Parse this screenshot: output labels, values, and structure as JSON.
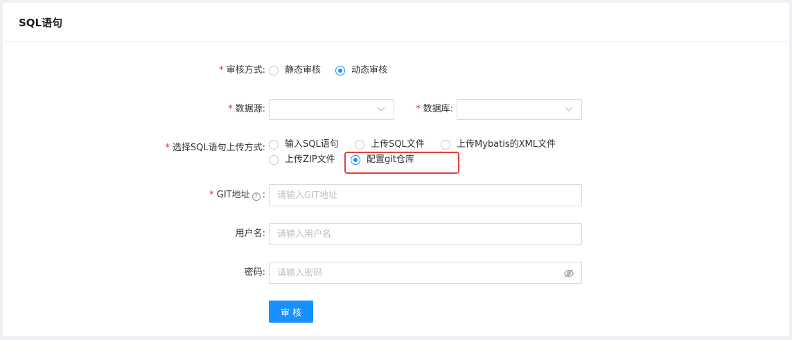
{
  "card": {
    "title": "SQL语句"
  },
  "form": {
    "required_mark": "*",
    "label_suffix": ":",
    "audit_mode": {
      "label": "审核方式",
      "options": [
        {
          "label": "静态审核",
          "checked": false
        },
        {
          "label": "动态审核",
          "checked": true
        }
      ]
    },
    "datasource": {
      "label": "数据源",
      "value": ""
    },
    "database": {
      "label": "数据库",
      "value": ""
    },
    "upload_mode": {
      "label": "选择SQL语句上传方式",
      "options": [
        {
          "label": "输入SQL语句",
          "checked": false
        },
        {
          "label": "上传SQL文件",
          "checked": false
        },
        {
          "label": "上传Mybatis的XML文件",
          "checked": false
        },
        {
          "label": "上传ZIP文件",
          "checked": false
        },
        {
          "label": "配置git仓库",
          "checked": true
        }
      ]
    },
    "git_address": {
      "label": "GIT地址",
      "help_icon": "question-circle-icon",
      "placeholder": "请输入GIT地址",
      "value": ""
    },
    "username": {
      "label": "用户名",
      "placeholder": "请输入用户名",
      "value": ""
    },
    "password": {
      "label": "密码",
      "placeholder": "请输入密码",
      "value": "",
      "toggle_icon": "eye-invisible-icon"
    },
    "submit_label": "审核"
  },
  "colors": {
    "primary": "#1890ff",
    "required": "#f5222d",
    "highlight": "#e0413e"
  }
}
